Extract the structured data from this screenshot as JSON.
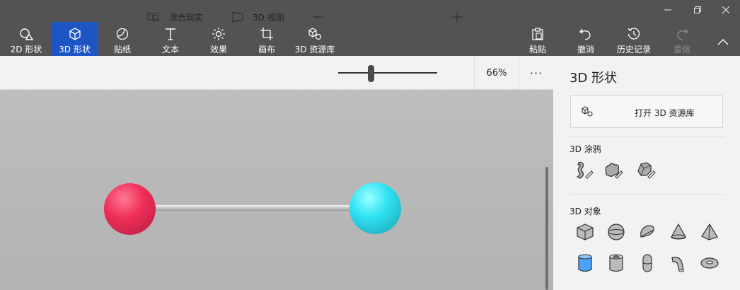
{
  "ribbon": {
    "tabs": [
      {
        "label": "2D 形状",
        "icon": "2d-shapes-icon"
      },
      {
        "label": "3D 形状",
        "icon": "3d-shapes-icon",
        "active": true
      },
      {
        "label": "贴纸",
        "icon": "stickers-icon"
      },
      {
        "label": "文本",
        "icon": "text-icon"
      },
      {
        "label": "效果",
        "icon": "effects-icon"
      },
      {
        "label": "画布",
        "icon": "canvas-icon"
      },
      {
        "label": "3D 资源库",
        "icon": "3d-library-icon"
      }
    ],
    "actions": [
      {
        "label": "粘贴",
        "icon": "paste-icon"
      },
      {
        "label": "撤消",
        "icon": "undo-icon"
      },
      {
        "label": "历史记录",
        "icon": "history-icon"
      },
      {
        "label": "重做",
        "icon": "redo-icon",
        "disabled": true
      }
    ]
  },
  "toolbar": {
    "mixed_reality_label": "混合现实",
    "view3d_label": "3D 视图",
    "zoom_value": "66%",
    "zoom_level": 0.33,
    "more_label": "···"
  },
  "panel": {
    "title": "3D 形状",
    "open_library_label": "打开 3D 资源库",
    "doodle_section": "3D 涂鸦",
    "doodle_tools": [
      "sharp-edge-doodle-icon",
      "soft-edge-doodle-icon",
      "faceted-doodle-icon"
    ],
    "objects_section": "3D 对象",
    "objects": [
      "cube-icon",
      "sphere-icon",
      "hemisphere-icon",
      "cone-icon",
      "pyramid-icon",
      "cylinder-icon",
      "tube-icon",
      "capsule-icon",
      "curved-tube-icon",
      "donut-icon"
    ]
  },
  "colors": {
    "ribbon_bg": "#535353",
    "active_tab": "#1d55c4",
    "sphere_left": "#e8325a",
    "sphere_right": "#38e0f0",
    "selected_object": "#4aa3ff"
  }
}
